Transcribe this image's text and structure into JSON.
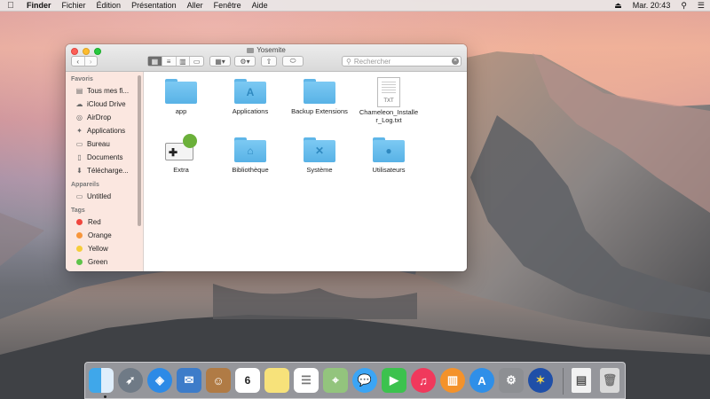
{
  "menubar": {
    "apple": "",
    "app": "Finder",
    "items": [
      "Fichier",
      "Édition",
      "Présentation",
      "Aller",
      "Fenêtre",
      "Aide"
    ],
    "clock": "Mar. 20:43"
  },
  "window": {
    "title": "Yosemite",
    "search_placeholder": "Rechercher"
  },
  "sidebar": {
    "favorites_header": "Favoris",
    "favorites": [
      {
        "label": "Tous mes fi...",
        "icon": "all-files-icon"
      },
      {
        "label": "iCloud Drive",
        "icon": "cloud-icon"
      },
      {
        "label": "AirDrop",
        "icon": "airdrop-icon"
      },
      {
        "label": "Applications",
        "icon": "applications-icon"
      },
      {
        "label": "Bureau",
        "icon": "desktop-icon"
      },
      {
        "label": "Documents",
        "icon": "documents-icon"
      },
      {
        "label": "Télécharge...",
        "icon": "downloads-icon"
      }
    ],
    "devices_header": "Appareils",
    "devices": [
      {
        "label": "Untitled",
        "icon": "disk-icon"
      }
    ],
    "tags_header": "Tags",
    "tags": [
      {
        "label": "Red",
        "color": "#f0463e"
      },
      {
        "label": "Orange",
        "color": "#f7963c"
      },
      {
        "label": "Yellow",
        "color": "#f6cd3a"
      },
      {
        "label": "Green",
        "color": "#5fc34a"
      }
    ]
  },
  "files": [
    {
      "name": "app",
      "kind": "folder"
    },
    {
      "name": "Applications",
      "kind": "folder-apps"
    },
    {
      "name": "Backup Extensions",
      "kind": "folder"
    },
    {
      "name": "Chameleon_Installer_Log.txt",
      "kind": "txt"
    },
    {
      "name": "Extra",
      "kind": "extra"
    },
    {
      "name": "Bibliothèque",
      "kind": "folder-library"
    },
    {
      "name": "Système",
      "kind": "folder-system"
    },
    {
      "name": "Utilisateurs",
      "kind": "folder-users"
    }
  ],
  "file_labels": {
    "f0": "app",
    "f1": "Applications",
    "f2": "Backup Extensions",
    "f3a": "Chameleon_Installe",
    "f3b": "r_Log.txt",
    "f4": "Extra",
    "f5": "Bibliothèque",
    "f6": "Système",
    "f7": "Utilisateurs",
    "txt_ext": "TXT",
    "cal_day": "6"
  },
  "dock": [
    "finder-icon",
    "launchpad-icon",
    "safari-icon",
    "mail-icon",
    "contacts-icon",
    "calendar-icon",
    "notes-icon",
    "reminders-icon",
    "maps-icon",
    "messages-icon",
    "facetime-icon",
    "itunes-icon",
    "ibooks-icon",
    "app-store-icon",
    "system-preferences-icon",
    "chameleon-wizard-icon",
    "document-icon",
    "trash-icon"
  ]
}
